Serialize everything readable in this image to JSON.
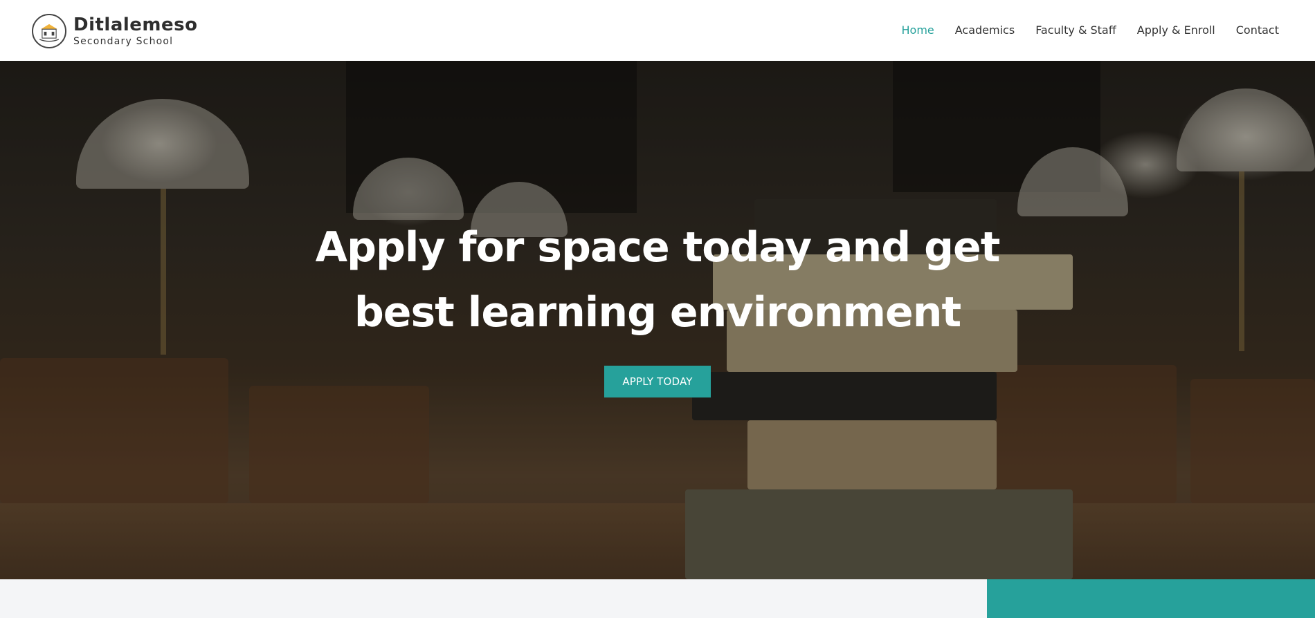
{
  "brand": {
    "name": "Ditlalemeso",
    "subtitle": "Secondary School",
    "logo_icon": "school-crest-icon"
  },
  "nav": {
    "items": [
      {
        "label": "Home",
        "active": true
      },
      {
        "label": "Academics",
        "active": false
      },
      {
        "label": "Faculty & Staff",
        "active": false
      },
      {
        "label": "Apply & Enroll",
        "active": false
      },
      {
        "label": "Contact",
        "active": false
      }
    ]
  },
  "hero": {
    "title_line1": "Apply for space today and get",
    "title_line2": "best learning environment",
    "cta_label": "APPLY TODAY"
  },
  "colors": {
    "accent": "#26a19b",
    "text_dark": "#333333",
    "light_bg": "#f4f5f7"
  }
}
